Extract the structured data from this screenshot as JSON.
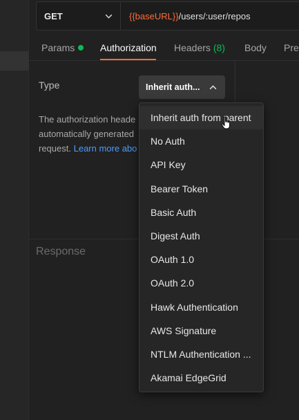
{
  "request": {
    "method": "GET",
    "url_variable": "{{baseURL}}",
    "url_path": "/users/:user/repos"
  },
  "tabs": [
    {
      "label": "Params",
      "has_dot": true
    },
    {
      "label": "Authorization",
      "active": true
    },
    {
      "label": "Headers",
      "count": "(8)"
    },
    {
      "label": "Body"
    },
    {
      "label": "Pre"
    }
  ],
  "auth": {
    "type_label": "Type",
    "selected_type": "Inherit auth...",
    "description_lines": [
      "The authorization heade",
      "automatically generated",
      "request."
    ],
    "learn_more_link": "Learn more abo"
  },
  "response": {
    "label": "Response"
  },
  "dropdown": {
    "options": [
      "Inherit auth from parent",
      "No Auth",
      "API Key",
      "Bearer Token",
      "Basic Auth",
      "Digest Auth",
      "OAuth 1.0",
      "OAuth 2.0",
      "Hawk Authentication",
      "AWS Signature",
      "NTLM Authentication ...",
      "Akamai EdgeGrid"
    ],
    "hovered_option": "Inherit auth from parent"
  },
  "colors": {
    "accent": "#ff6c37",
    "success": "#0cbb52",
    "link": "#4c9bff",
    "background": "#212121"
  }
}
